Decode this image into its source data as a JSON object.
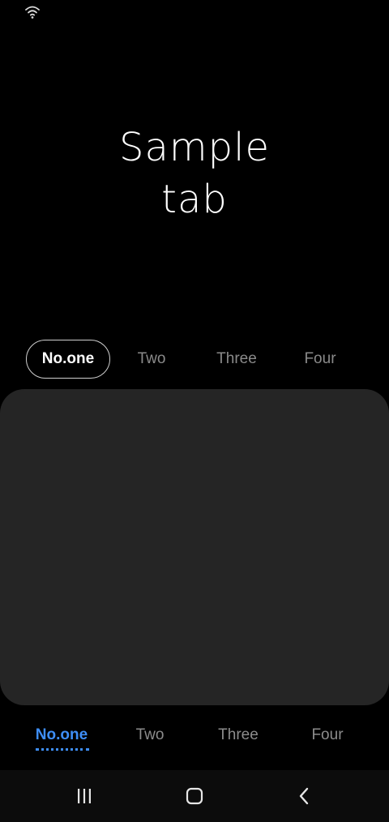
{
  "status_bar": {
    "icons": [
      "wifi-icon"
    ]
  },
  "header": {
    "title_lines": [
      "Sample",
      "tab"
    ]
  },
  "top_tabs": {
    "items": [
      {
        "label": "No.one",
        "selected": true
      },
      {
        "label": "Two",
        "selected": false
      },
      {
        "label": "Three",
        "selected": false
      },
      {
        "label": "Four",
        "selected": false
      }
    ]
  },
  "bottom_tabs": {
    "items": [
      {
        "label": "No.one",
        "selected": true
      },
      {
        "label": "Two",
        "selected": false
      },
      {
        "label": "Three",
        "selected": false
      },
      {
        "label": "Four",
        "selected": false
      }
    ]
  },
  "nav_bar": {
    "icons": [
      "recent-apps-icon",
      "home-icon",
      "back-icon"
    ]
  },
  "colors": {
    "background": "#000000",
    "card": "#252525",
    "accent": "#3e8ef7",
    "inactive_text": "#8a8a8a",
    "nav_bar": "#0c0c0c"
  }
}
